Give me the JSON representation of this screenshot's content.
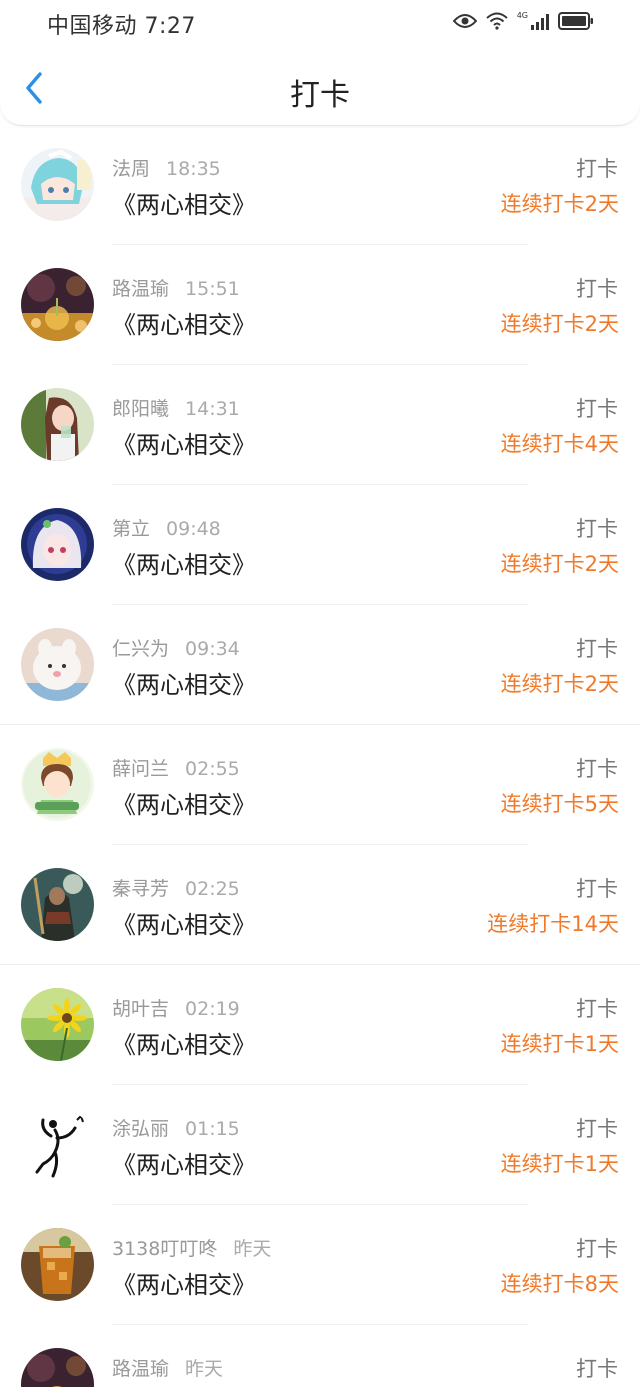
{
  "status_bar": {
    "carrier_time": "中国移动 7:27",
    "network": "4G"
  },
  "header": {
    "title": "打卡",
    "back_icon": "chevron-left-icon"
  },
  "colors": {
    "accent_blue": "#2a8fe6",
    "streak_orange": "#f07a2a"
  },
  "entries": [
    {
      "name": "法周",
      "time": "18:35",
      "book": "《两心相交》",
      "action": "打卡",
      "streak": "连续打卡2天",
      "avatar": "anime-girl-avatar"
    },
    {
      "name": "路温瑜",
      "time": "15:51",
      "book": "《两心相交》",
      "action": "打卡",
      "streak": "连续打卡2天",
      "avatar": "sunset-bokeh-avatar"
    },
    {
      "name": "郎阳曦",
      "time": "14:31",
      "book": "《两心相交》",
      "action": "打卡",
      "streak": "连续打卡4天",
      "avatar": "girl-photo-avatar"
    },
    {
      "name": "第立",
      "time": "09:48",
      "book": "《两心相交》",
      "action": "打卡",
      "streak": "连续打卡2天",
      "avatar": "anime-white-hair-avatar"
    },
    {
      "name": "仁兴为",
      "time": "09:34",
      "book": "《两心相交》",
      "action": "打卡",
      "streak": "连续打卡2天",
      "avatar": "plush-toy-avatar"
    },
    {
      "name": "薛问兰",
      "time": "02:55",
      "book": "《两心相交》",
      "action": "打卡",
      "streak": "连续打卡5天",
      "avatar": "cartoon-boy-avatar"
    },
    {
      "name": "秦寻芳",
      "time": "02:25",
      "book": "《两心相交》",
      "action": "打卡",
      "streak": "连续打卡14天",
      "avatar": "warrior-avatar"
    },
    {
      "name": "胡叶吉",
      "time": "02:19",
      "book": "《两心相交》",
      "action": "打卡",
      "streak": "连续打卡1天",
      "avatar": "flower-avatar"
    },
    {
      "name": "涂弘丽",
      "time": "01:15",
      "book": "《两心相交》",
      "action": "打卡",
      "streak": "连续打卡1天",
      "avatar": "stick-figure-avatar"
    },
    {
      "name": "3138叮叮咚",
      "time": "昨天",
      "book": "《两心相交》",
      "action": "打卡",
      "streak": "连续打卡8天",
      "avatar": "iced-tea-avatar"
    },
    {
      "name": "路温瑜",
      "time": "昨天",
      "book": "",
      "action": "打卡",
      "streak": "",
      "avatar": "sunset-bokeh-avatar"
    }
  ]
}
